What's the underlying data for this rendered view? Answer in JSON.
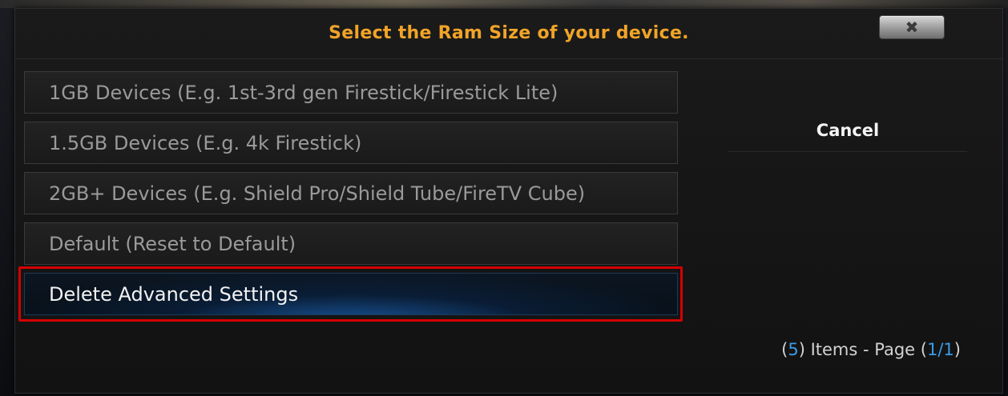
{
  "dialog": {
    "title": "Select the Ram Size of your device.",
    "close_icon": "close-icon",
    "close_glyph": "✖"
  },
  "list": {
    "items": [
      {
        "label": "1GB Devices (E.g. 1st-3rd gen Firestick/Firestick Lite)",
        "focused": false
      },
      {
        "label": "1.5GB Devices (E.g. 4k Firestick)",
        "focused": false
      },
      {
        "label": "2GB+ Devices (E.g. Shield Pro/Shield Tube/FireTV Cube)",
        "focused": false
      },
      {
        "label": "Default (Reset to Default)",
        "focused": false
      },
      {
        "label": "Delete Advanced Settings",
        "focused": true
      }
    ]
  },
  "side": {
    "cancel_label": "Cancel"
  },
  "footer": {
    "open_paren": "(",
    "item_count": "5",
    "items_text": ") Items - Page (",
    "current_page": "1",
    "slash": "/",
    "total_pages": "1",
    "close_paren": ")"
  },
  "colors": {
    "title": "#f0a428",
    "highlight_border": "#d40000",
    "page_number": "#3a9be8"
  }
}
